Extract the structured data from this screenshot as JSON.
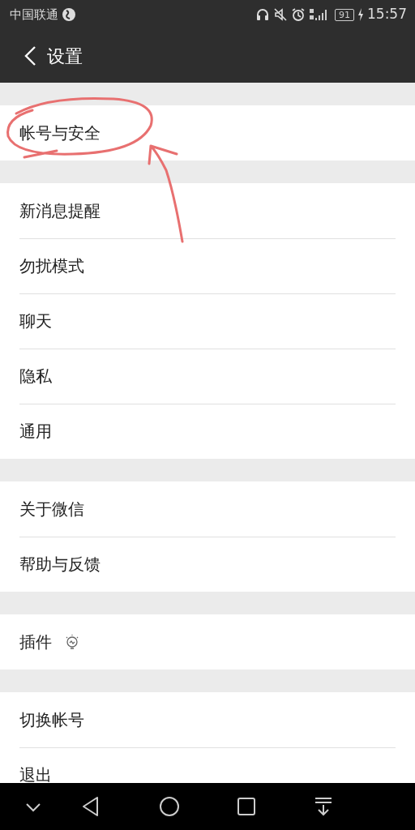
{
  "status_bar": {
    "carrier": "中国联通",
    "battery": "91",
    "time": "15:57"
  },
  "header": {
    "title": "设置"
  },
  "groups": [
    {
      "items": [
        {
          "label": "帐号与安全",
          "annotated": true
        }
      ]
    },
    {
      "items": [
        {
          "label": "新消息提醒"
        },
        {
          "label": "勿扰模式"
        },
        {
          "label": "聊天"
        },
        {
          "label": "隐私"
        },
        {
          "label": "通用"
        }
      ]
    },
    {
      "items": [
        {
          "label": "关于微信"
        },
        {
          "label": "帮助与反馈"
        }
      ]
    },
    {
      "items": [
        {
          "label": "插件",
          "kind": "with-icon"
        }
      ]
    },
    {
      "items": [
        {
          "label": "切换帐号"
        },
        {
          "label": "退出"
        }
      ]
    }
  ]
}
